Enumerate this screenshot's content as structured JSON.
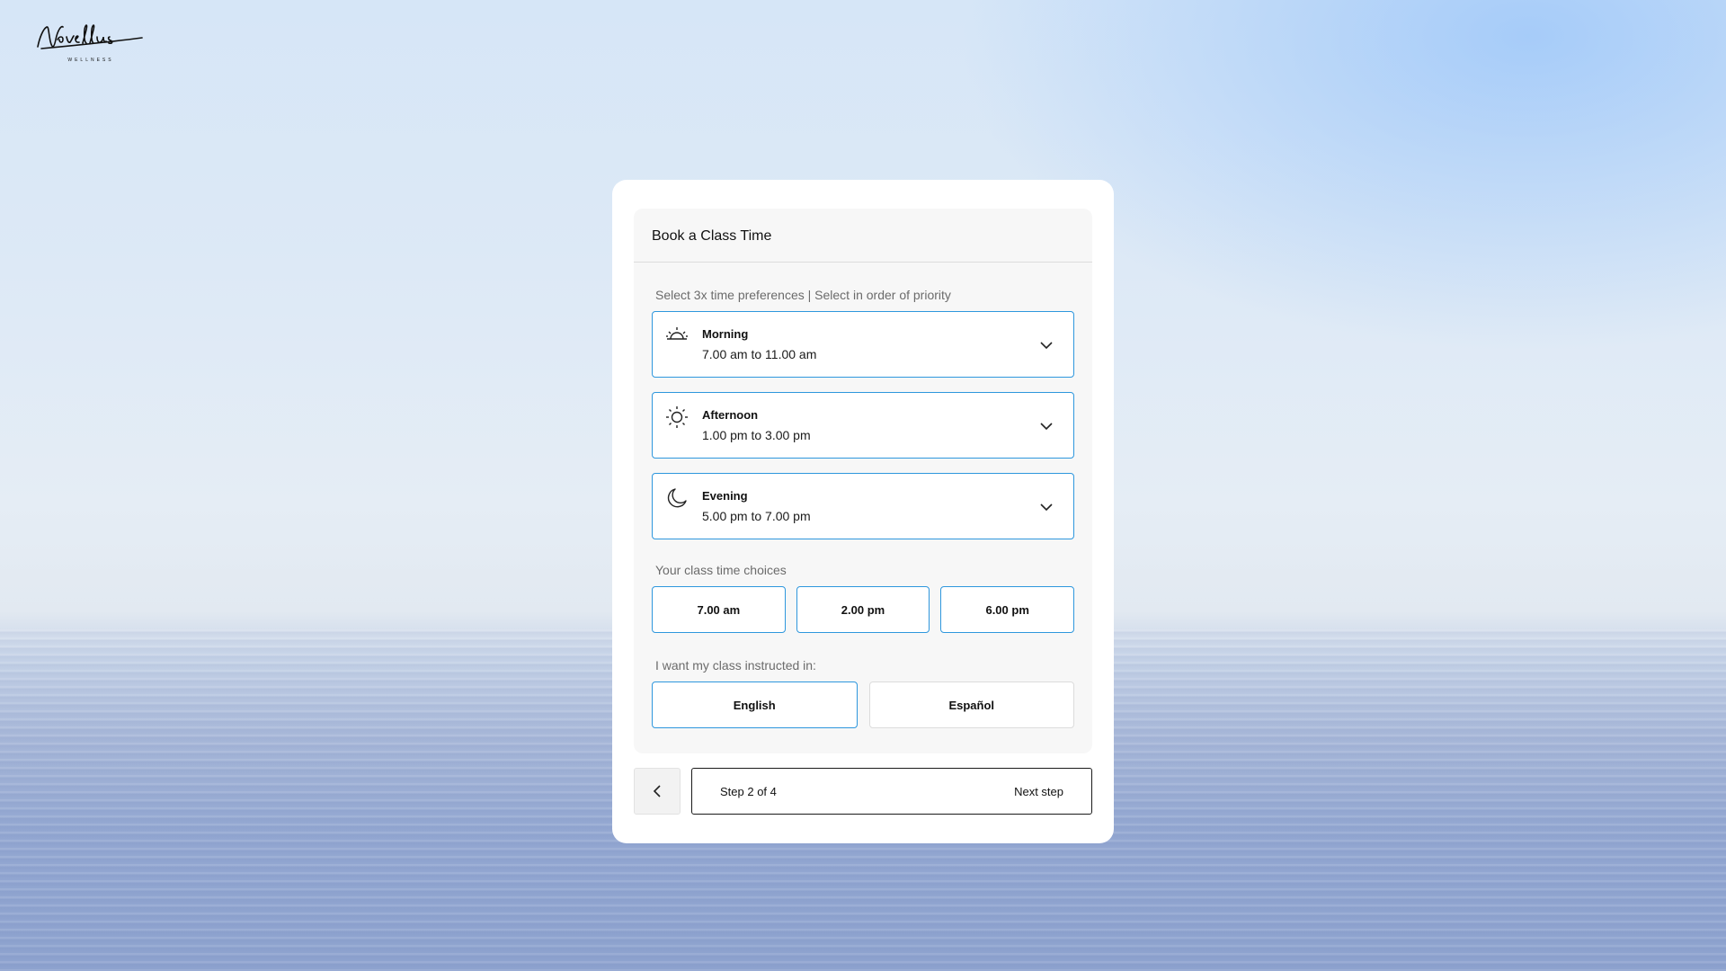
{
  "brand": {
    "logo_text": "Novellus",
    "logo_subtext": "WELLNESS"
  },
  "colors": {
    "accent": "#2e97dd",
    "panel_bg": "#f7f7f7",
    "card_bg": "#ffffff"
  },
  "booking": {
    "title": "Book a Class Time",
    "preferences_label": "Select 3x time preferences | Select in order of priority",
    "slots": [
      {
        "icon": "sunrise-icon",
        "name": "Morning",
        "time": "7.00 am to 11.00 am"
      },
      {
        "icon": "sun-icon",
        "name": "Afternoon",
        "time": "1.00 pm to 3.00 pm"
      },
      {
        "icon": "moon-icon",
        "name": "Evening",
        "time": "5.00 pm to 7.00 pm"
      }
    ],
    "choices_label": "Your class time choices",
    "choices": [
      "7.00 am",
      "2.00 pm",
      "6.00 pm"
    ],
    "language_label": "I want my class instructed in:",
    "languages": [
      {
        "label": "English",
        "selected": true
      },
      {
        "label": "Español",
        "selected": false
      }
    ]
  },
  "footer": {
    "back_icon": "chevron-left-icon",
    "step_text": "Step 2 of 4",
    "next_label": "Next step"
  }
}
